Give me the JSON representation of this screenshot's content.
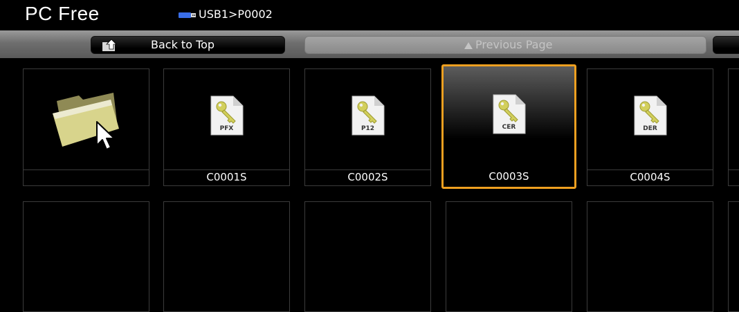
{
  "app": {
    "title": "PC Free"
  },
  "breadcrumb": {
    "path": "USB1>P0002",
    "device_icon": "usb-drive-icon"
  },
  "toolbar": {
    "back_label": "Back to Top",
    "back_icon": "folder-up-icon",
    "prev_label": "Previous Page",
    "prev_icon": "triangle-up-icon"
  },
  "items": [
    {
      "name": "",
      "type": "folder-icon"
    },
    {
      "name": "C0001S",
      "ext": "PFX",
      "type": "key-file-icon"
    },
    {
      "name": "C0002S",
      "ext": "P12",
      "type": "key-file-icon"
    },
    {
      "name": "C0003S",
      "ext": "CER",
      "type": "key-file-icon",
      "selected": true
    },
    {
      "name": "C0004S",
      "ext": "DER",
      "type": "key-file-icon"
    }
  ],
  "colors": {
    "selection": "#f0a020",
    "background": "#000000",
    "toolbar": "#7a7a7a"
  }
}
